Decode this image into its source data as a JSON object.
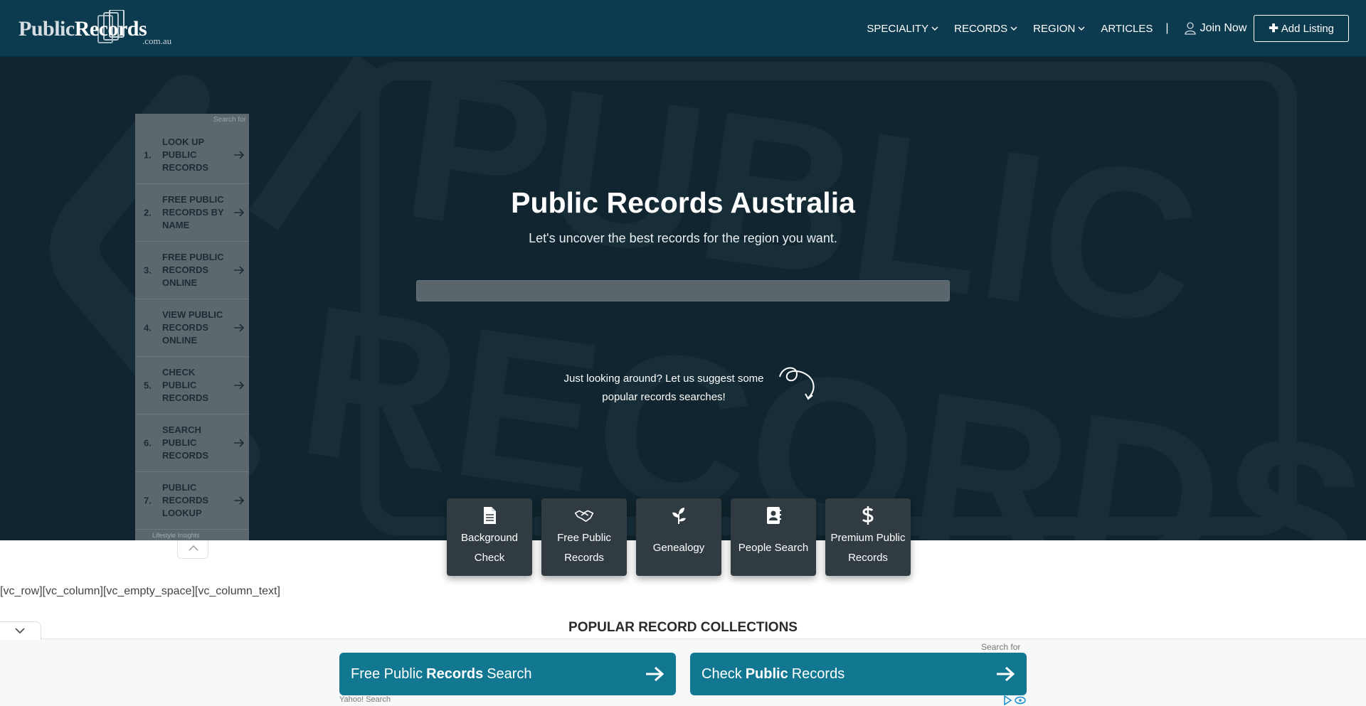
{
  "colors": {
    "navbar": "#0c3a4f",
    "hero": "#10252f",
    "card": "#303b42",
    "accent": "#127891"
  },
  "header": {
    "logo_text_a": "Public",
    "logo_text_b": "Records",
    "logo_sub": ".com.au",
    "nav": [
      {
        "label": "SPECIALITY",
        "dropdown": true
      },
      {
        "label": "RECORDS",
        "dropdown": true
      },
      {
        "label": "REGION",
        "dropdown": true
      },
      {
        "label": "ARTICLES",
        "dropdown": false
      }
    ],
    "separator": "|",
    "join_label": "Join Now",
    "add_listing_label": "Add Listing"
  },
  "hero": {
    "title": "Public Records Australia",
    "subtitle": "Let's uncover the best records for the region you want.",
    "search_placeholder": "",
    "suggest_text": "Just looking around? Let us suggest some popular records searches!",
    "watermark_text_1": "PUBLIC",
    "watermark_text_2": "RECORDS"
  },
  "side_ad": {
    "search_for": "Search for",
    "items": [
      {
        "num": "1.",
        "label": "LOOK UP PUBLIC RECORDS"
      },
      {
        "num": "2.",
        "label": "FREE PUBLIC RECORDS BY NAME"
      },
      {
        "num": "3.",
        "label": "FREE PUBLIC RECORDS ONLINE"
      },
      {
        "num": "4.",
        "label": "VIEW PUBLIC RECORDS ONLINE"
      },
      {
        "num": "5.",
        "label": "CHECK PUBLIC RECORDS"
      },
      {
        "num": "6.",
        "label": "SEARCH PUBLIC RECORDS"
      },
      {
        "num": "7.",
        "label": "PUBLIC RECORDS LOOKUP"
      }
    ],
    "footer": "Lifestyle Insights"
  },
  "cards": [
    {
      "label": "Background Check",
      "icon": "document-icon"
    },
    {
      "label": "Free Public Records",
      "icon": "handshake-icon"
    },
    {
      "label": "Genealogy",
      "icon": "plant-icon"
    },
    {
      "label": "People Search",
      "icon": "contact-book-icon"
    },
    {
      "label": "Premium Public Records",
      "icon": "dollar-icon"
    }
  ],
  "content": {
    "shortcode": "[vc_row][vc_column][vc_empty_space][vc_column_text]",
    "popular_heading": "POPULAR RECORD COLLECTIONS"
  },
  "bottom_ad": {
    "search_for": "Search for",
    "btn1": {
      "pre": "Free Public",
      "bold": "Records",
      "post": "Search"
    },
    "btn2": {
      "pre": "Check",
      "bold": "Public",
      "post": "Records"
    },
    "provider": "Yahoo! Search"
  }
}
